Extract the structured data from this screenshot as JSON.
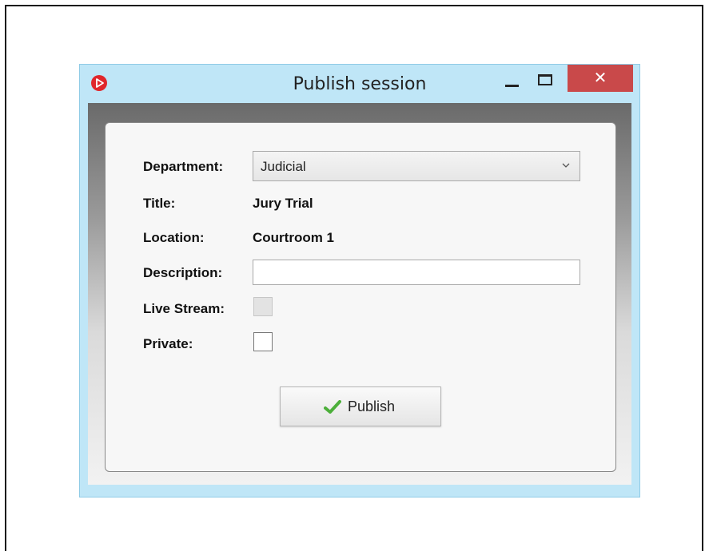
{
  "window": {
    "title": "Publish session",
    "close_glyph": "✕",
    "icons": {
      "app": "play-icon",
      "minimize": "minimize-icon",
      "maximize": "maximize-icon",
      "close": "close-icon"
    },
    "colors": {
      "titlebar": "#bfe6f7",
      "close": "#c9494a",
      "app_icon": "#e0262b"
    }
  },
  "form": {
    "department": {
      "label": "Department:",
      "value": "Judicial",
      "icon": "chevron-down-icon"
    },
    "title": {
      "label": "Title:",
      "value": "Jury Trial"
    },
    "location": {
      "label": "Location:",
      "value": "Courtroom 1"
    },
    "description": {
      "label": "Description:",
      "value": ""
    },
    "live_stream": {
      "label": "Live Stream:",
      "checked": false,
      "enabled": false
    },
    "private": {
      "label": "Private:",
      "checked": false,
      "enabled": true
    }
  },
  "publish_button": {
    "label": "Publish",
    "icon": "checkmark-icon",
    "icon_color": "#4caf3a"
  }
}
